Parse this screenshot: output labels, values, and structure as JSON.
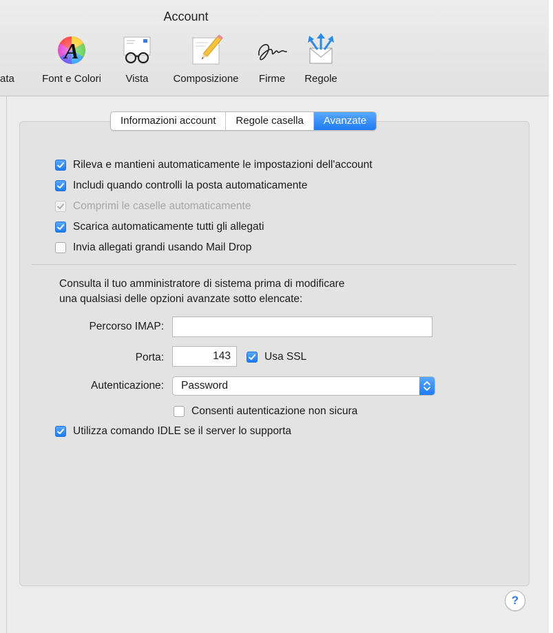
{
  "window": {
    "title": "Account"
  },
  "toolbar": {
    "partial_label": "ata",
    "items": [
      {
        "label": "Font e Colori",
        "icon": "fonts-colors-icon"
      },
      {
        "label": "Vista",
        "icon": "view-glasses-icon"
      },
      {
        "label": "Composizione",
        "icon": "composing-pencil-icon"
      },
      {
        "label": "Firme",
        "icon": "signature-icon"
      },
      {
        "label": "Regole",
        "icon": "rules-envelope-icon"
      }
    ]
  },
  "tabs": [
    {
      "label": "Informazioni account",
      "active": false
    },
    {
      "label": "Regole casella",
      "active": false
    },
    {
      "label": "Avanzate",
      "active": true
    }
  ],
  "options": [
    {
      "label": "Rileva e mantieni automaticamente le impostazioni dell'account",
      "checked": true,
      "enabled": true
    },
    {
      "label": "Includi quando controlli la posta automaticamente",
      "checked": true,
      "enabled": true
    },
    {
      "label": "Comprimi le caselle automaticamente",
      "checked": true,
      "enabled": false
    },
    {
      "label": "Scarica automaticamente tutti gli allegati",
      "checked": true,
      "enabled": true
    },
    {
      "label": "Invia allegati grandi usando Mail Drop",
      "checked": false,
      "enabled": true
    }
  ],
  "advanced": {
    "info_line1": "Consulta il tuo amministratore di sistema prima di modificare",
    "info_line2": "una qualsiasi delle opzioni avanzate sotto elencate:",
    "imap_path_label": "Percorso IMAP:",
    "imap_path_value": "",
    "port_label": "Porta:",
    "port_value": "143",
    "use_ssl_label": "Usa SSL",
    "use_ssl_checked": true,
    "auth_label": "Autenticazione:",
    "auth_value": "Password",
    "allow_insecure_label": "Consenti autenticazione non sicura",
    "allow_insecure_checked": false,
    "idle_label": "Utilizza comando IDLE se il server lo supporta",
    "idle_checked": true
  },
  "help": {
    "label": "?"
  },
  "colors": {
    "accent": "#1e7cf2",
    "panel": "#e3e3e3",
    "window": "#ececec"
  }
}
